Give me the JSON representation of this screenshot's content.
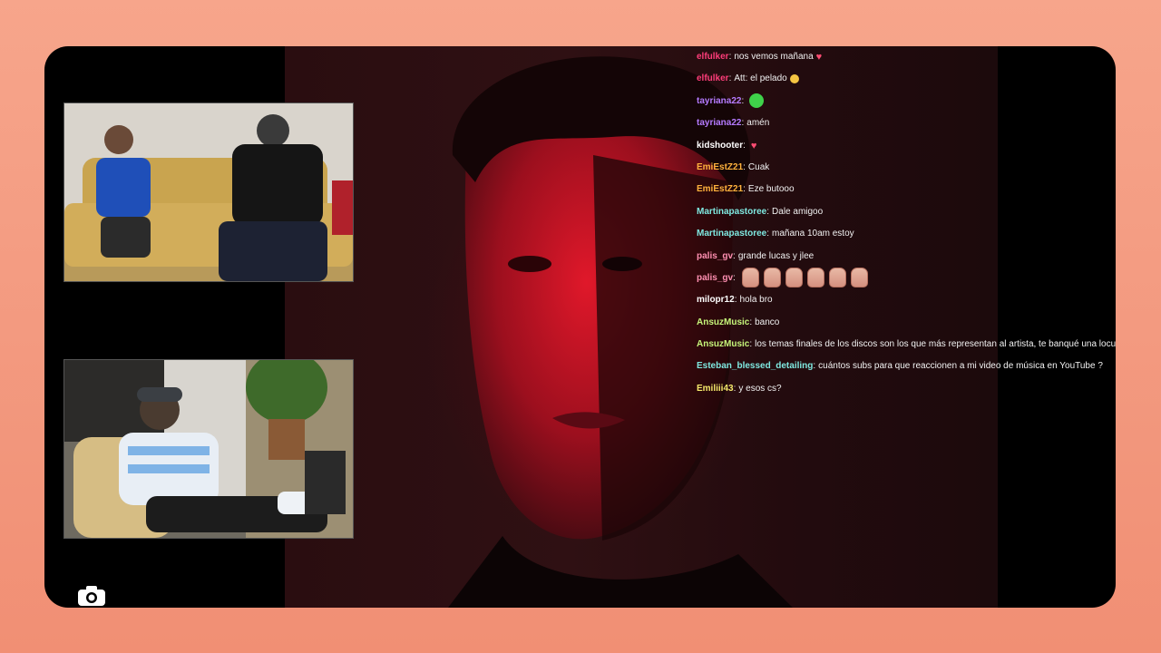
{
  "colors": {
    "page_background": "#f39a80",
    "frame_background": "#000000",
    "chat_text": "#f2f2f2"
  },
  "chat": {
    "messages": [
      {
        "user": "elfulker",
        "color": "#ff3d7a",
        "text": "nos vemos mañana",
        "emote": "heart"
      },
      {
        "user": "elfulker",
        "color": "#ff3d7a",
        "text": "Att: el pelado",
        "emote": "smile"
      },
      {
        "user": "tayriana22",
        "color": "#b57bff",
        "text": "",
        "emote": "pepe"
      },
      {
        "user": "tayriana22",
        "color": "#b57bff",
        "text": "amén",
        "emote": ""
      },
      {
        "user": "kidshooter",
        "color": "#ffffff",
        "text": "",
        "emote": "heart"
      },
      {
        "user": "EmiEstZ21",
        "color": "#ffb23d",
        "text": "Cuak",
        "emote": ""
      },
      {
        "user": "EmiEstZ21",
        "color": "#ffb23d",
        "text": "Eze butooo",
        "emote": ""
      },
      {
        "user": "Martinapastoree",
        "color": "#7fe8e0",
        "text": "Dale amigoo",
        "emote": ""
      },
      {
        "user": "Martinapastoree",
        "color": "#7fe8e0",
        "text": "mañana 10am estoy",
        "emote": ""
      },
      {
        "user": "palis_gv",
        "color": "#ff8fb1",
        "text": "grande lucas y jlee",
        "emote": ""
      },
      {
        "user": "palis_gv",
        "color": "#ff8fb1",
        "text": "",
        "emote": "pigs"
      },
      {
        "user": "milopr12",
        "color": "#ffffff",
        "text": "hola bro",
        "emote": ""
      },
      {
        "user": "AnsuzMusic",
        "color": "#c6f57a",
        "text": "banco",
        "emote": ""
      },
      {
        "user": "AnsuzMusic",
        "color": "#c6f57a",
        "text": "los temas finales de los discos son los que más representan al artista, te banqué una locura",
        "emote": ""
      },
      {
        "user": "Esteban_blessed_detailing",
        "color": "#7fe8e0",
        "text": "cuántos subs para que reaccionen a mi video de música en YouTube ?",
        "emote": ""
      },
      {
        "user": "Emiliii43",
        "color": "#f5e96b",
        "text": "y esos cs?",
        "emote": ""
      }
    ]
  },
  "icons": {
    "camera": "camera-icon"
  }
}
